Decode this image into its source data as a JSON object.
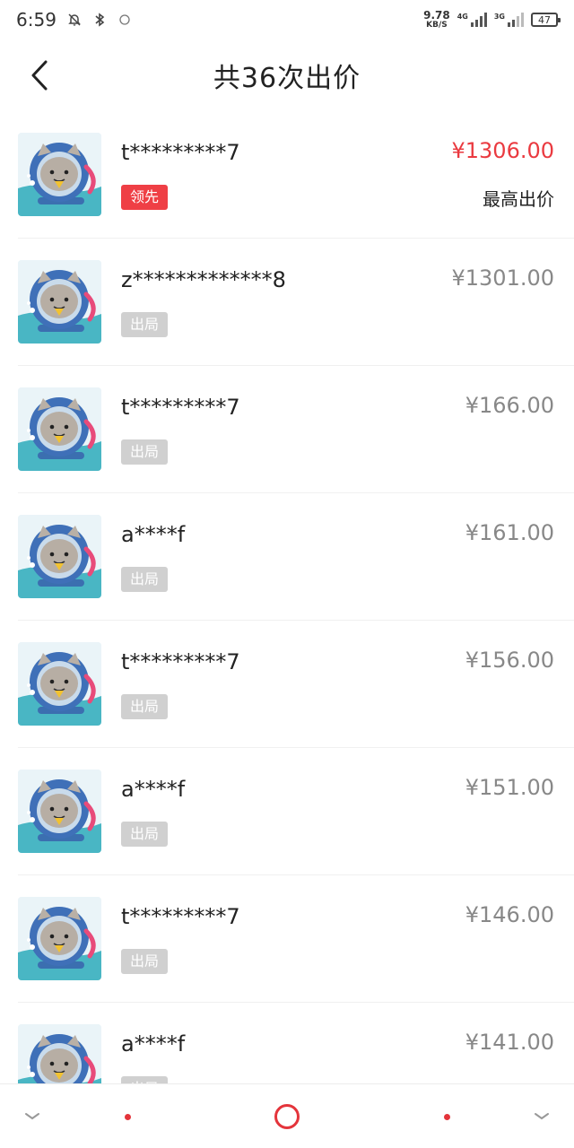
{
  "status_bar": {
    "time": "6:59",
    "net_speed_value": "9.78",
    "net_speed_unit": "KB/S",
    "sim1_type": "4G",
    "sim2_type": "3G",
    "battery": "47"
  },
  "header": {
    "title": "共36次出价"
  },
  "bids": [
    {
      "username": "t*********7",
      "status": "领先",
      "price": "¥1306.00",
      "note": "最高出价"
    },
    {
      "username": "z*************8",
      "status": "出局",
      "price": "¥1301.00"
    },
    {
      "username": "t*********7",
      "status": "出局",
      "price": "¥166.00"
    },
    {
      "username": "a****f",
      "status": "出局",
      "price": "¥161.00"
    },
    {
      "username": "t*********7",
      "status": "出局",
      "price": "¥156.00"
    },
    {
      "username": "a****f",
      "status": "出局",
      "price": "¥151.00"
    },
    {
      "username": "t*********7",
      "status": "出局",
      "price": "¥146.00"
    },
    {
      "username": "a****f",
      "status": "出局",
      "price": "¥141.00"
    }
  ],
  "colors": {
    "accent_red": "#ea3a40",
    "badge_out_gray": "#d0d0d0",
    "price_gray": "#888888"
  }
}
